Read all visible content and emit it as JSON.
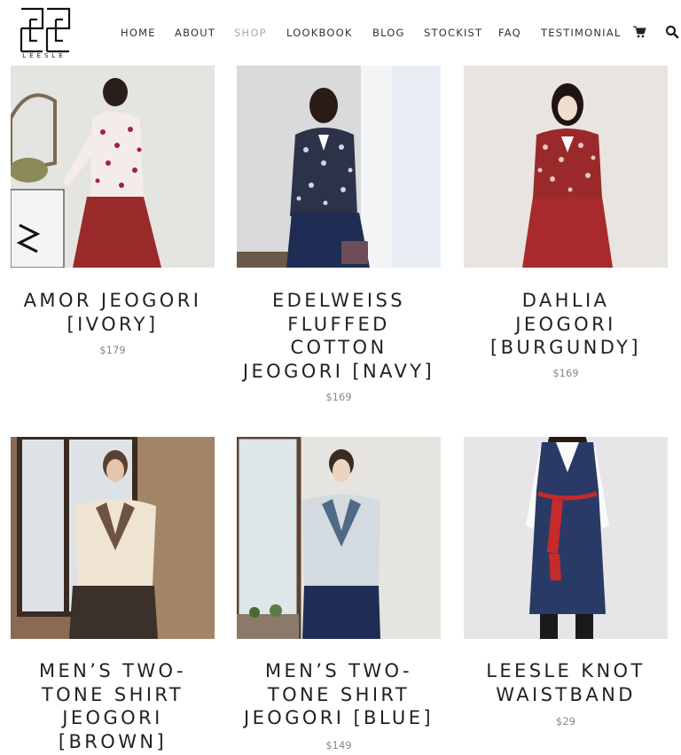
{
  "brand": {
    "name": "LEESLE",
    "logo_text": "LEESLE"
  },
  "nav": {
    "items": [
      {
        "label": "HOME"
      },
      {
        "label": "ABOUT"
      },
      {
        "label": "SHOP",
        "active": true
      },
      {
        "label": "LOOKBOOK"
      },
      {
        "label": "BLOG"
      },
      {
        "label": "STOCKIST"
      },
      {
        "label": "FAQ"
      },
      {
        "label": "TESTIMONIAL"
      }
    ],
    "cart_icon": "shopping-cart-icon",
    "search_icon": "search-icon"
  },
  "products": [
    {
      "title_lines": [
        "AMOR JEOGORI",
        "[IVORY]"
      ],
      "price": "$179",
      "image": "woman in floral ivory jeogori with red skirt"
    },
    {
      "title_lines": [
        "EDELWEISS",
        "FLUFFED",
        "COTTON",
        "JEOGORI [NAVY]"
      ],
      "price": "$169",
      "image": "woman in navy floral jeogori with navy skirt"
    },
    {
      "title_lines": [
        "DAHLIA",
        "JEOGORI",
        "[BURGUNDY]"
      ],
      "price": "$169",
      "image": "woman in burgundy floral jeogori"
    },
    {
      "title_lines": [
        "MEN’S TWO-",
        "TONE SHIRT",
        "JEOGORI",
        "[BROWN]"
      ],
      "price": "",
      "image": "man in beige and brown two-tone jeogori"
    },
    {
      "title_lines": [
        "MEN’S TWO-",
        "TONE SHIRT",
        "JEOGORI [BLUE]"
      ],
      "price": "$149",
      "image": "man in light blue two-tone jeogori"
    },
    {
      "title_lines": [
        "LEESLE KNOT",
        "WAISTBAND"
      ],
      "price": "$29",
      "image": "navy vest dress with red knot waistband"
    }
  ],
  "colors": {
    "text": "#222222",
    "nav_active": "#aaaaaa",
    "price": "#888888",
    "burgundy": "#9a2a2a",
    "navy": "#1f2d55"
  }
}
